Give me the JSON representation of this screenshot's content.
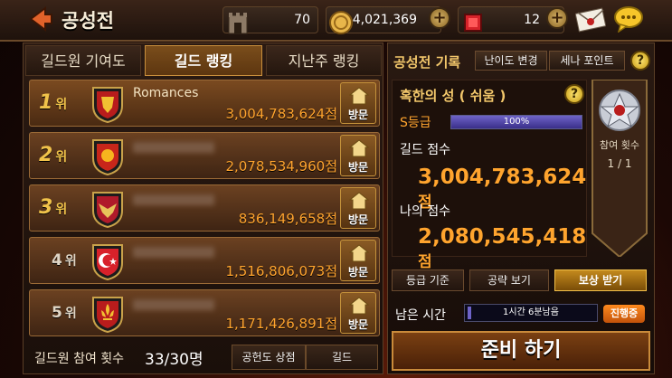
{
  "header": {
    "title": "공성전",
    "resources": [
      {
        "icon": "tower-icon",
        "value": "70"
      },
      {
        "icon": "gold-coin-icon",
        "value": "4,021,369"
      },
      {
        "icon": "ruby-gem-icon",
        "value": "12"
      }
    ],
    "icons": [
      "back-arrow-icon",
      "mail-icon",
      "chat-bubble-icon"
    ]
  },
  "left": {
    "tabs": [
      {
        "label": "길드원 기여도",
        "active": false
      },
      {
        "label": "길드 랭킹",
        "active": true
      },
      {
        "label": "지난주 랭킹",
        "active": false
      }
    ],
    "rankings": [
      {
        "rank": "1",
        "suffix": "위",
        "name": "Romances",
        "score": "3,004,783,624점",
        "emblem": "red-lion-emblem-icon",
        "visit": "방문"
      },
      {
        "rank": "2",
        "suffix": "위",
        "name": "",
        "score": "2,078,534,960점",
        "emblem": "sun-emblem-icon",
        "visit": "방문"
      },
      {
        "rank": "3",
        "suffix": "위",
        "name": "",
        "score": "836,149,658점",
        "emblem": "eagle-emblem-icon",
        "visit": "방문"
      },
      {
        "rank": "4",
        "suffix": "위",
        "name": "",
        "score": "1,516,806,073점",
        "emblem": "crescent-emblem-icon",
        "visit": "방문"
      },
      {
        "rank": "5",
        "suffix": "위",
        "name": "",
        "score": "1,171,426,891점",
        "emblem": "fleur-de-lis-emblem-icon",
        "visit": "방문"
      }
    ],
    "participation_label": "길드원 참여 횟수",
    "participation_count": "33/30명",
    "contribution_shop": "공헌도 상점",
    "guild_button": "길드"
  },
  "right": {
    "title": "공성전 기록",
    "difficulty_button": "난이도 변경",
    "sena_points_button": "세나 포인트",
    "castle_name": "혹한의 성 ( 쉬움 )",
    "grade": "S등급",
    "progress": "100%",
    "progress_value": 1.0,
    "guild_score_label": "길드 점수",
    "guild_score": "3,004,783,624",
    "guild_score_unit": "점",
    "my_score_label": "나의 점수",
    "my_score": "2,080,545,418",
    "my_score_unit": "점",
    "participation_label": "참여 횟수",
    "participation_value": "1 / 1",
    "buttons": [
      "등급 기준",
      "공략 보기",
      "보상 받기"
    ],
    "time_left_label": "남은 시간",
    "time_left": "1시간 6분남음",
    "status": "진행중",
    "ready_button": "준비 하기"
  }
}
